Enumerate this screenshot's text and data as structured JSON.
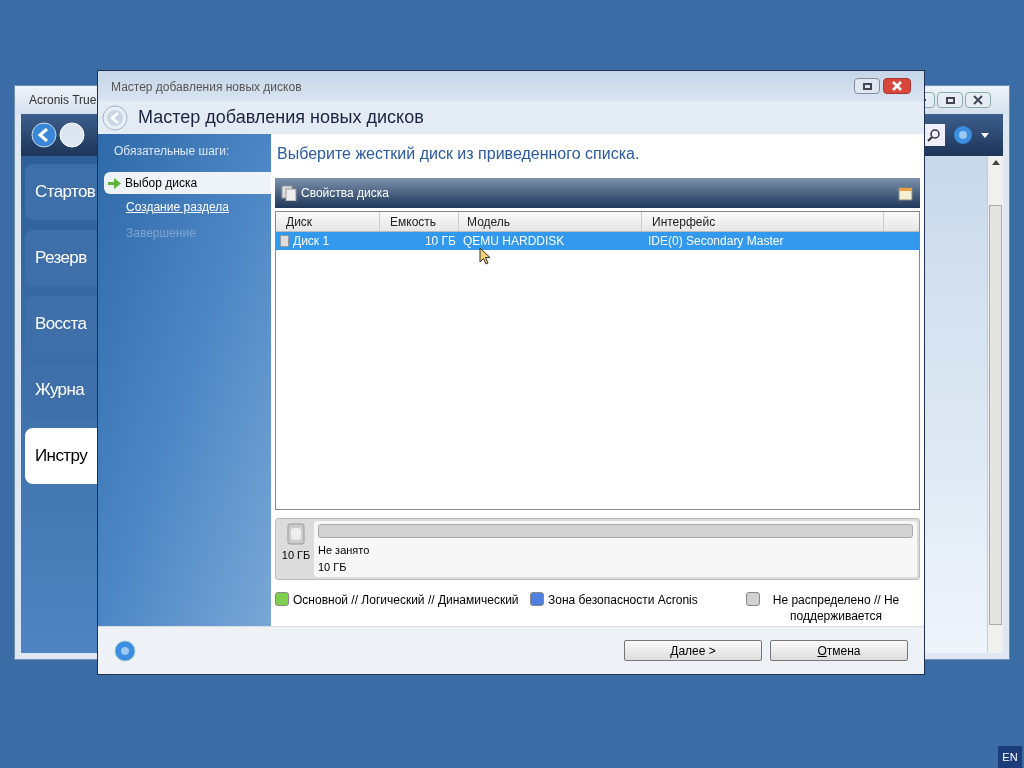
{
  "background_window": {
    "title": "Acronis True",
    "nav_items": [
      {
        "label": "Стартов",
        "selected": false
      },
      {
        "label": "Резерв",
        "selected": false
      },
      {
        "label": "Восста",
        "selected": false
      },
      {
        "label": "Журна",
        "selected": false
      },
      {
        "label": "Инстру",
        "selected": true
      }
    ]
  },
  "dialog": {
    "title": "Мастер добавления новых дисков",
    "heading": "Мастер добавления новых дисков",
    "steps_header": "Обязательные шаги:",
    "steps": [
      {
        "label": "Выбор диска",
        "selected": true,
        "disabled": false
      },
      {
        "label": "Создание раздела",
        "selected": false,
        "disabled": false
      },
      {
        "label": "Завершение",
        "selected": false,
        "disabled": true
      }
    ],
    "instruction": "Выберите жесткий диск из приведенного списка.",
    "toolbar": {
      "label": "Свойства диска"
    },
    "table": {
      "columns": [
        "Диск",
        "Емкость",
        "Модель",
        "Интерфейс"
      ],
      "rows": [
        {
          "cells": [
            "Диск 1",
            "10 ГБ",
            "QEMU HARDDISK",
            "IDE(0) Secondary Master"
          ],
          "selected": true
        }
      ]
    },
    "disk_map": {
      "size": "10 ГБ",
      "partitions": [
        {
          "label": "Не занято",
          "size": "10 ГБ"
        }
      ]
    },
    "legend": [
      {
        "label": "Основной // Логический // Динамический",
        "color": "#7fcf4f"
      },
      {
        "label": "Зона безопасности Acronis",
        "color": "#4f7fdf"
      },
      {
        "label": "Не распределено // Не поддерживается",
        "color": "#d0d0d0"
      }
    ],
    "buttons": [
      "Далее >",
      "Отмена"
    ]
  },
  "language_indicator": "EN"
}
